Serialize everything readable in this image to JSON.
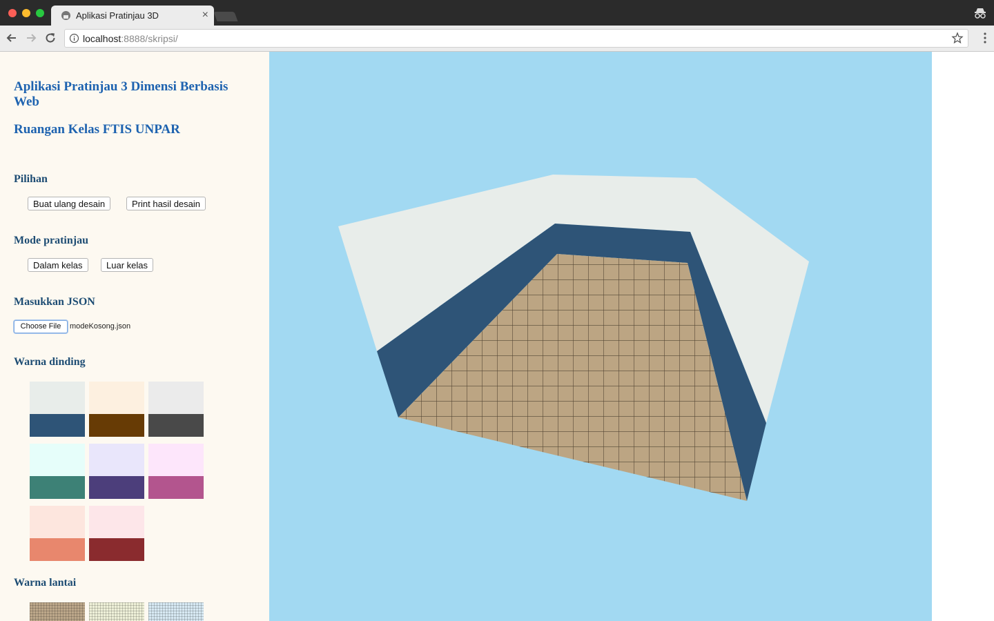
{
  "browser": {
    "tab_title": "Aplikasi Pratinjau 3D",
    "url_host": "localhost",
    "url_rest": ":8888/skripsi/"
  },
  "sidebar": {
    "app_title": "Aplikasi Pratinjau 3 Dimensi Berbasis Web",
    "room_title": "Ruangan Kelas FTIS UNPAR",
    "options": {
      "title": "Pilihan",
      "rebuild_label": "Buat ulang desain",
      "print_label": "Print hasil desain"
    },
    "preview_mode": {
      "title": "Mode pratinjau",
      "inside_label": "Dalam kelas",
      "outside_label": "Luar kelas"
    },
    "json_input": {
      "title": "Masukkan JSON",
      "choose_label": "Choose File",
      "file_name": "modeKosong.json"
    },
    "wall_colors": {
      "title": "Warna dinding",
      "swatches": [
        {
          "light": "#e8edea",
          "dark": "#2e5477"
        },
        {
          "light": "#fdf0e0",
          "dark": "#673b05"
        },
        {
          "light": "#ebebeb",
          "dark": "#494949"
        },
        {
          "light": "#e6fefa",
          "dark": "#3d8176"
        },
        {
          "light": "#e9e6fb",
          "dark": "#4c3e7b"
        },
        {
          "light": "#fde6fb",
          "dark": "#b3558e"
        },
        {
          "light": "#fde6de",
          "dark": "#e8876d"
        },
        {
          "light": "#fde6e9",
          "dark": "#8a2b2e"
        }
      ]
    },
    "floor_colors": {
      "title": "Warna lantai",
      "swatches": [
        "#bca78a",
        "#eef0d8",
        "#d7e9f3"
      ]
    }
  },
  "scene": {
    "sky_color": "#a2d9f2",
    "wall_outer_color": "#e8edea",
    "wall_inner_color": "#2e5477",
    "floor_color": "#c8b08c"
  }
}
